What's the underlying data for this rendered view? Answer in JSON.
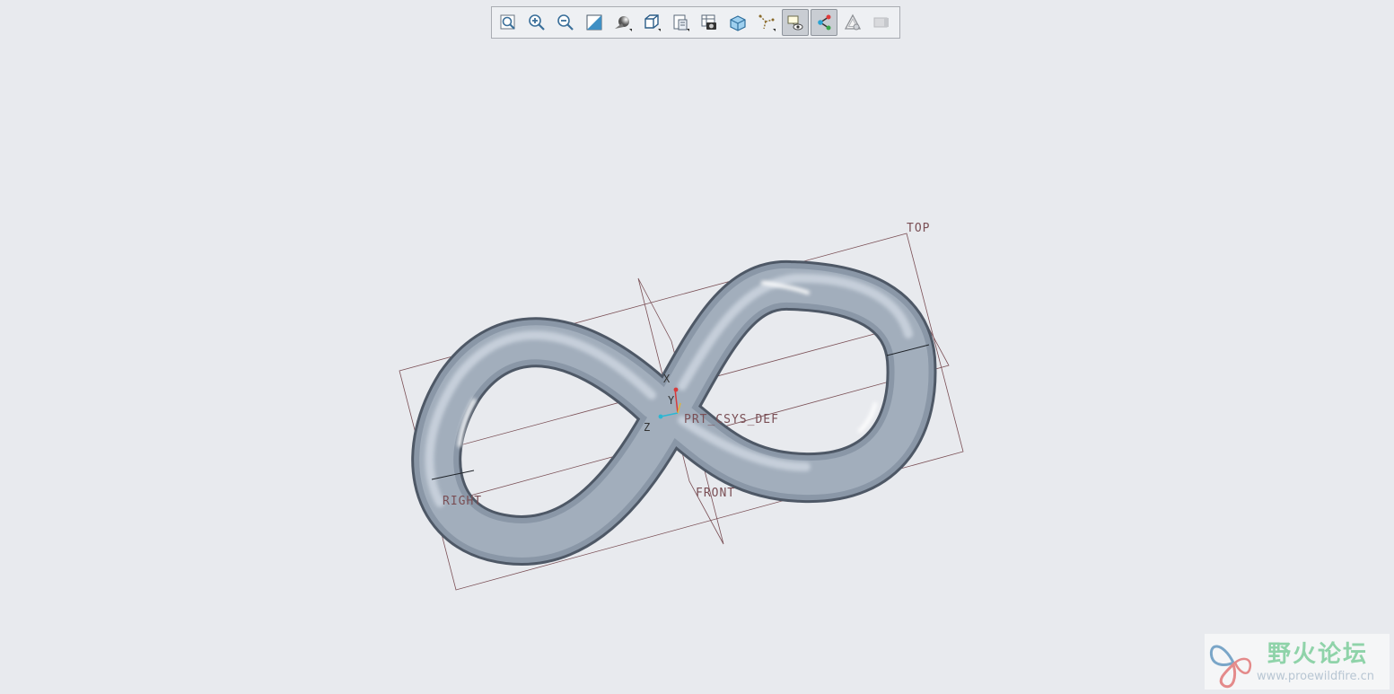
{
  "toolbar": {
    "buttons": [
      {
        "name": "refit-icon",
        "label": "Refit",
        "active": false
      },
      {
        "name": "zoom-in-icon",
        "label": "Zoom In",
        "active": false
      },
      {
        "name": "zoom-out-icon",
        "label": "Zoom Out",
        "active": false
      },
      {
        "name": "repaint-icon",
        "label": "Repaint",
        "active": false
      },
      {
        "name": "display-style-icon",
        "label": "Display Style",
        "active": false
      },
      {
        "name": "saved-orientations-icon",
        "label": "Saved Orientations",
        "active": false
      },
      {
        "name": "view-manager-icon",
        "label": "View Manager",
        "active": false
      },
      {
        "name": "section-icon",
        "label": "Section",
        "active": false
      },
      {
        "name": "appearance-icon",
        "label": "Appearance",
        "active": false
      },
      {
        "name": "datum-display-icon",
        "label": "Datum Display Filters",
        "active": false
      },
      {
        "name": "annotation-display-icon",
        "label": "Annotation Display",
        "active": true
      },
      {
        "name": "spin-center-icon",
        "label": "Spin Center",
        "active": true
      },
      {
        "name": "perspective-icon",
        "label": "Perspective View",
        "active": false
      },
      {
        "name": "placeholder-icon",
        "label": "Disabled",
        "active": false
      }
    ]
  },
  "viewport": {
    "planes": {
      "top": "TOP",
      "right": "RIGHT",
      "front": "FRONT"
    },
    "csys": {
      "name": "PRT_CSYS_DEF",
      "x": "X",
      "y": "Y",
      "z": "Z"
    },
    "model_color": "#a2aebc",
    "datum_color": "#7a4f55"
  },
  "watermark": {
    "title": "野火论坛",
    "url": "www.proewildfire.cn"
  }
}
